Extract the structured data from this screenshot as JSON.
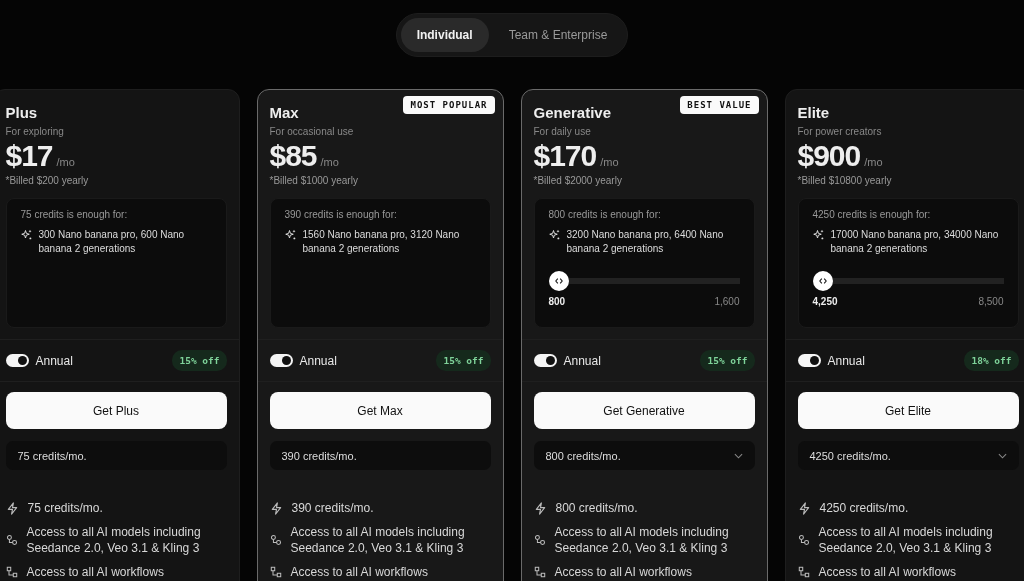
{
  "tabs": [
    {
      "label": "Individual",
      "selected": true
    },
    {
      "label": "Team & Enterprise",
      "selected": false
    }
  ],
  "plans": [
    {
      "name": "Plus",
      "tagline": "For exploring",
      "price": "$17",
      "period": "/mo",
      "billed": "*Billed $200 yearly",
      "highlighted": false,
      "credits_note": "75 credits is enough for:",
      "usage": "300 Nano banana pro, 600 Nano banana 2 generations",
      "annual": {
        "label": "Annual",
        "on": true
      },
      "discount": "15% off",
      "cta": "Get Plus",
      "credits_select": {
        "value": "75 credits/mo.",
        "dropdown": false
      },
      "features": [
        {
          "kind": "bolt",
          "text": "75 credits/mo."
        },
        {
          "kind": "models",
          "text": "Access to all AI models including Seedance 2.0, Veo 3.1 & Kling 3"
        },
        {
          "kind": "workflows",
          "text": "Access to all AI workflows"
        }
      ]
    },
    {
      "name": "Max",
      "tagline": "For occasional use",
      "price": "$85",
      "period": "/mo",
      "billed": "*Billed $1000 yearly",
      "badge": "MOST POPULAR",
      "highlighted": true,
      "credits_note": "390 credits is enough for:",
      "usage": "1560 Nano banana pro, 3120 Nano banana 2 generations",
      "annual": {
        "label": "Annual",
        "on": true
      },
      "discount": "15% off",
      "cta": "Get Max",
      "credits_select": {
        "value": "390 credits/mo.",
        "dropdown": false
      },
      "features": [
        {
          "kind": "bolt",
          "text": "390 credits/mo."
        },
        {
          "kind": "models",
          "text": "Access to all AI models including Seedance 2.0, Veo 3.1 & Kling 3"
        },
        {
          "kind": "workflows",
          "text": "Access to all AI workflows"
        }
      ]
    },
    {
      "name": "Generative",
      "tagline": "For daily use",
      "price": "$170",
      "period": "/mo",
      "billed": "*Billed $2000 yearly",
      "badge": "BEST VALUE",
      "highlighted": true,
      "credits_note": "800 credits is enough for:",
      "usage": "3200 Nano banana pro, 6400 Nano banana 2 generations",
      "slider": {
        "level": 0,
        "min_label": "800",
        "max_label": "1,600"
      },
      "annual": {
        "label": "Annual",
        "on": true
      },
      "discount": "15% off",
      "cta": "Get Generative",
      "credits_select": {
        "value": "800 credits/mo.",
        "dropdown": true
      },
      "features": [
        {
          "kind": "bolt",
          "text": "800 credits/mo."
        },
        {
          "kind": "models",
          "text": "Access to all AI models including Seedance 2.0, Veo 3.1 & Kling 3"
        },
        {
          "kind": "workflows",
          "text": "Access to all AI workflows"
        }
      ]
    },
    {
      "name": "Elite",
      "tagline": "For power creators",
      "price": "$900",
      "period": "/mo",
      "billed": "*Billed $10800 yearly",
      "highlighted": false,
      "credits_note": "4250 credits is enough for:",
      "usage": "17000 Nano banana pro, 34000 Nano banana 2 generations",
      "slider": {
        "level": 0,
        "min_label": "4,250",
        "max_label": "8,500"
      },
      "annual": {
        "label": "Annual",
        "on": true
      },
      "discount": "18% off",
      "cta": "Get Elite",
      "credits_select": {
        "value": "4250 credits/mo.",
        "dropdown": true
      },
      "features": [
        {
          "kind": "bolt",
          "text": "4250 credits/mo."
        },
        {
          "kind": "models",
          "text": "Access to all AI models including Seedance 2.0, Veo 3.1 & Kling 3"
        },
        {
          "kind": "workflows",
          "text": "Access to all AI workflows"
        }
      ]
    }
  ]
}
